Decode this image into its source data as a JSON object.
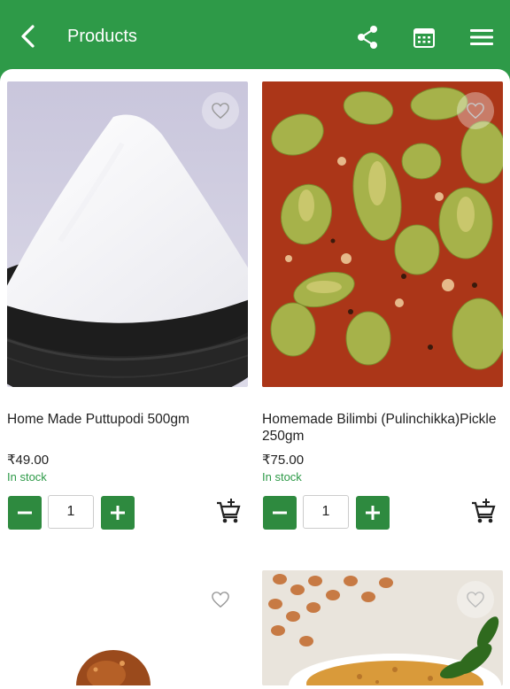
{
  "header": {
    "title": "Products",
    "icons": [
      "back-arrow-icon",
      "share-icon",
      "calendar-icon",
      "menu-icon"
    ]
  },
  "products": [
    {
      "name": "Home Made Puttupodi  500gm",
      "price": "₹49.00",
      "stock": "In stock",
      "quantity": "1",
      "image": "white flour in black clay pot"
    },
    {
      "name": "Homemade Bilimbi (Pulinchikka)Pickle 250gm",
      "price": "₹75.00",
      "stock": "In stock",
      "quantity": "1",
      "image": "bilimbi pickle in red masala"
    },
    {
      "image": "fried snack on white background"
    },
    {
      "image": "peanuts and spice mix with curry leaves"
    }
  ],
  "colors": {
    "brand_green": "#2e9a48",
    "button_green": "#2e8a3f",
    "stock_green": "#2e9a48"
  }
}
